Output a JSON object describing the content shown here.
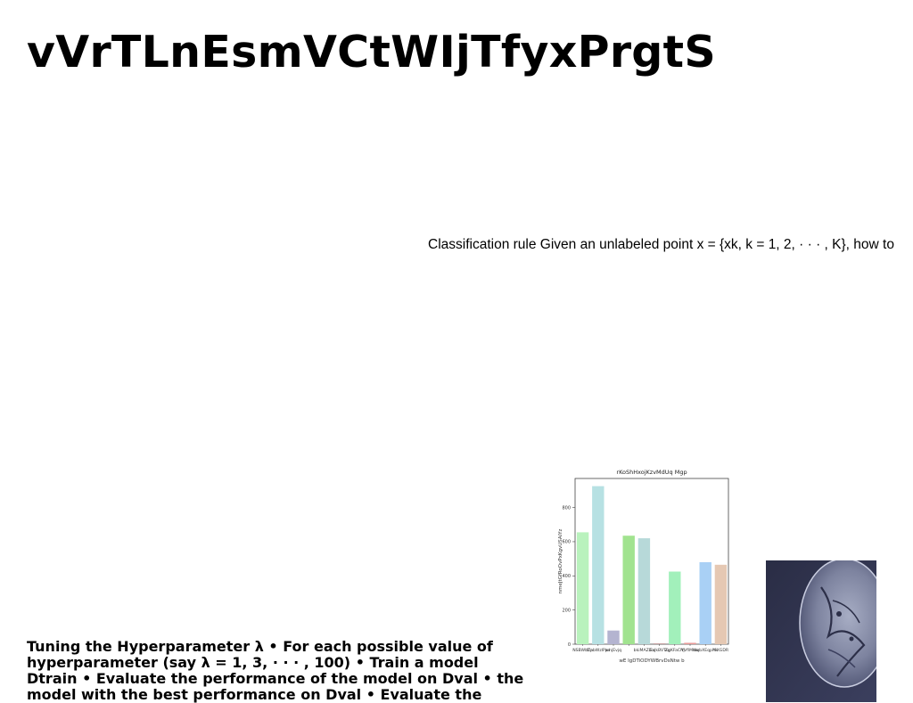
{
  "slide": {
    "title": "vVrTLnEsmVCtWIjTfyxPrgtS",
    "right_text": "Classification rule Given an unlabeled point x = {xk, k = 1, 2, · · · , K}, how to",
    "bottom_text": "Tuning the Hyperparameter λ • For each possible value of hyperparameter (say λ = 1, 3, · · · , 100) • Train a model Dtrain • Evaluate the performance of the model on Dval • the model with the best performance on Dval • Evaluate the"
  },
  "chart_data": {
    "type": "bar",
    "title": "rKoShHxojKzvMdUq Mgp",
    "xlabel": "wE IgDTiODYWBrvDsNtw b",
    "ylabel": "nmeJtGfRoOvPxKgvUSAiYz",
    "categories": [
      "NSBWbZa",
      "fLpbWzlPwl",
      "jnnjEvjq",
      "bkiMAZGa",
      "iFaJkBVTsq",
      "ZgKFaCNj",
      "YVfiMew",
      "WqbXEqpMv",
      "YiXGDR"
    ],
    "values": [
      655,
      925,
      80,
      635,
      620,
      5,
      425,
      8,
      480,
      465
    ],
    "bar_labels": [
      "NSBWbZa",
      "fLpbWzlPwl",
      "jnnjEvjq",
      "",
      "bkiMAZGa",
      "iFaJkBVTsq",
      "ZgKFaCNj",
      "YVfiMew",
      "WqbXEqpMv",
      "YiXGDR"
    ],
    "colors": [
      "#b9f2bd",
      "#b7e1e3",
      "#b4b4d0",
      "#a1e38f",
      "#b7d9d9",
      "#c6a0a0",
      "#a2f0bb",
      "#e89a98",
      "#a9d0f5",
      "#e5c8b3"
    ],
    "yticks": [
      0,
      200,
      400,
      600,
      800
    ],
    "ylim": [
      0,
      970
    ],
    "grid": false
  },
  "images": {
    "photo_icon": "mirror-photo"
  }
}
